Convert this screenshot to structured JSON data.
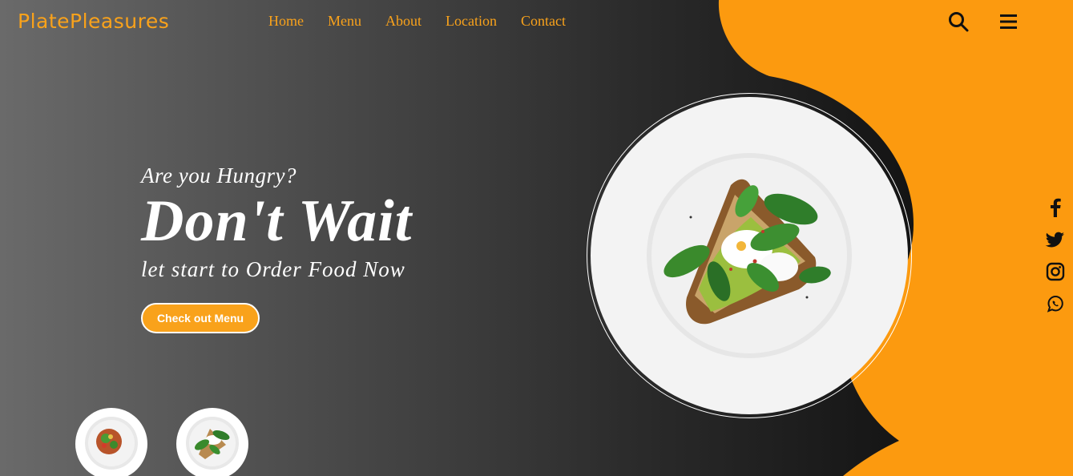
{
  "brand": {
    "name": "PlatePleasures"
  },
  "nav": {
    "items": [
      "Home",
      "Menu",
      "About",
      "Location",
      "Contact"
    ]
  },
  "header_icons": {
    "search": "search-icon",
    "menu": "hamburger-menu-icon"
  },
  "hero": {
    "kicker": "Are you Hungry?",
    "headline": "Don't Wait",
    "sub": "let start to Order Food Now",
    "cta_label": "Check out Menu"
  },
  "social": [
    "facebook-icon",
    "twitter-icon",
    "instagram-icon",
    "whatsapp-icon"
  ],
  "colors": {
    "accent": "#f9a21b",
    "text": "#ffffff",
    "dark": "#1a1a1a"
  }
}
